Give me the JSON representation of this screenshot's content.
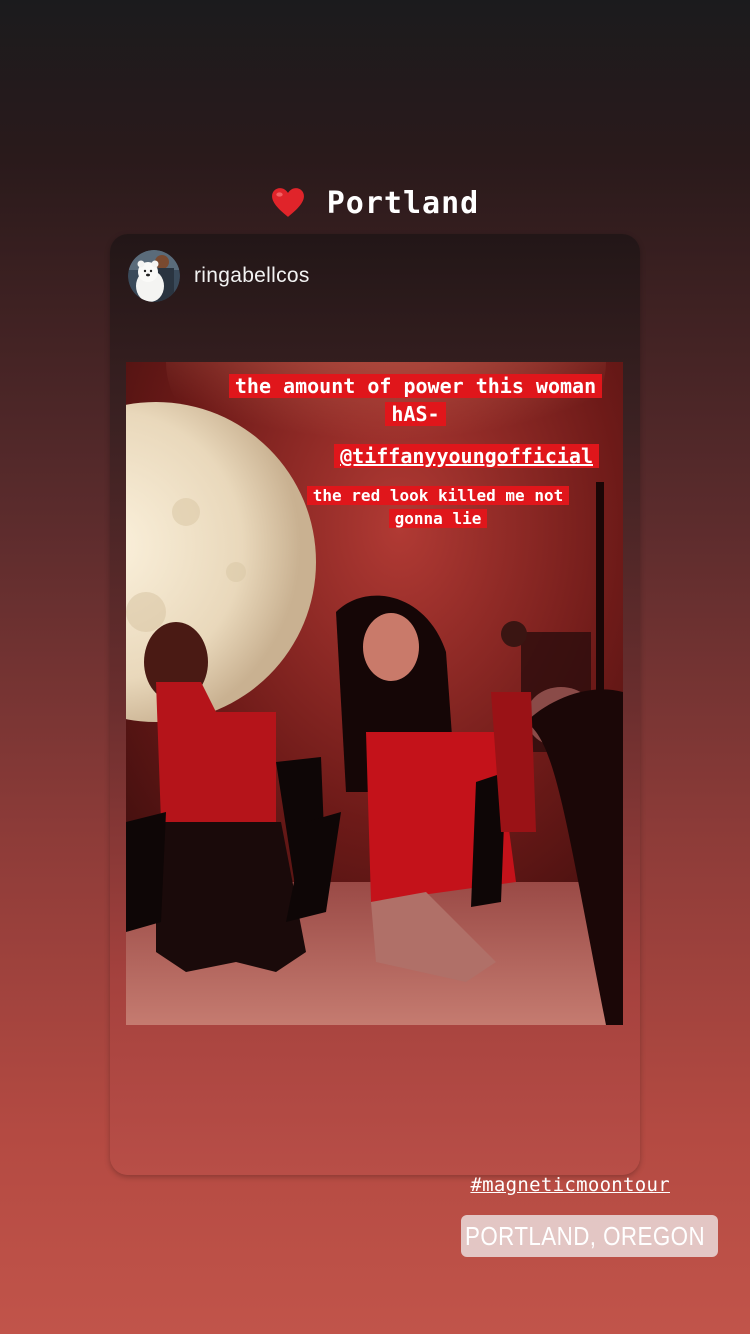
{
  "story": {
    "title": "Portland",
    "title_icon": "heart-icon"
  },
  "post": {
    "username": "ringabellcos",
    "avatar_icon": "avatar-polar-bear"
  },
  "captions": {
    "line1": "the amount of power this woman hAS-",
    "mention": "@tiffanyyoungofficial",
    "line3": "the red look killed me not gonna lie"
  },
  "stickers": {
    "hashtag": "#magneticmoontour",
    "location": "PORTLAND, OREGON",
    "location_icon": "location-pin-icon"
  },
  "colors": {
    "caption_highlight": "#e0161b",
    "heart": "#e0242a"
  }
}
